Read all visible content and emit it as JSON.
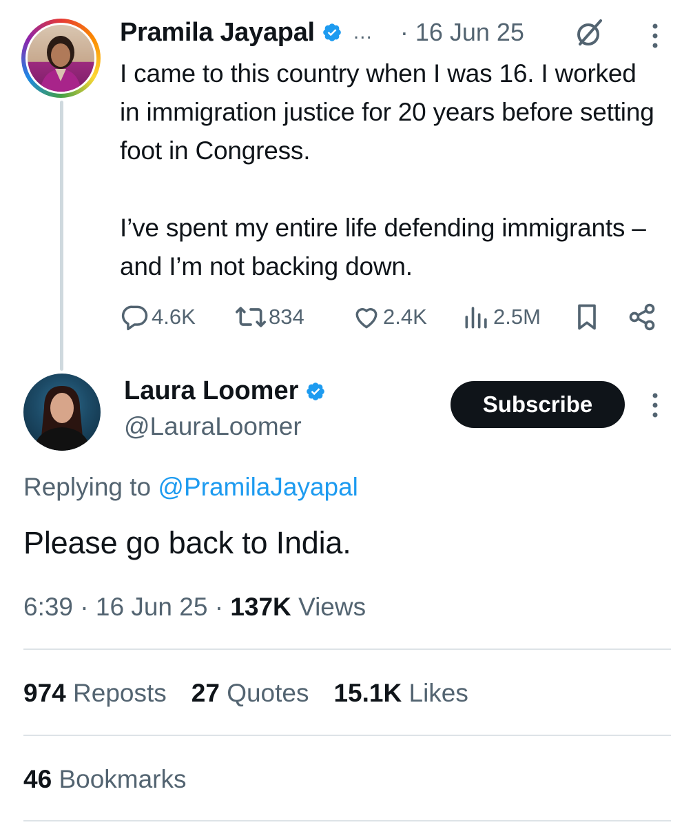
{
  "parent_tweet": {
    "author_name": "Pramila Jayapal",
    "truncation": "...",
    "date": "· 16 Jun 25",
    "text_paragraphs": [
      "I came to this country when I was 16. I worked in immigration justice for 20 years before setting foot in Congress.",
      "I’ve spent my entire life defending immigrants – and I’m not backing down."
    ],
    "counts": {
      "replies": "4.6K",
      "reposts": "834",
      "likes": "2.4K",
      "views": "2.5M"
    }
  },
  "reply_tweet": {
    "author_name": "Laura Loomer",
    "handle": "@LauraLoomer",
    "subscribe_label": "Subscribe",
    "replying_prefix": "Replying to",
    "replying_mention": "@PramilaJayapal",
    "text": "Please go back to India.",
    "time": "6:39",
    "date": "16 Jun 25",
    "separator": "·",
    "views_count": "137K",
    "views_label": "Views"
  },
  "engagement": {
    "reposts_count": "974",
    "reposts_label": "Reposts",
    "quotes_count": "27",
    "quotes_label": "Quotes",
    "likes_count": "15.1K",
    "likes_label": "Likes",
    "bookmarks_count": "46",
    "bookmarks_label": "Bookmarks"
  },
  "colors": {
    "text_primary": "#0f1419",
    "text_secondary": "#536471",
    "accent_blue": "#1d9bf0",
    "divider": "#dde3e7"
  },
  "icons": [
    "verified-badge-icon",
    "grok-icon",
    "more-icon",
    "reply-icon",
    "repost-icon",
    "like-icon",
    "views-icon",
    "bookmark-icon",
    "share-icon"
  ]
}
